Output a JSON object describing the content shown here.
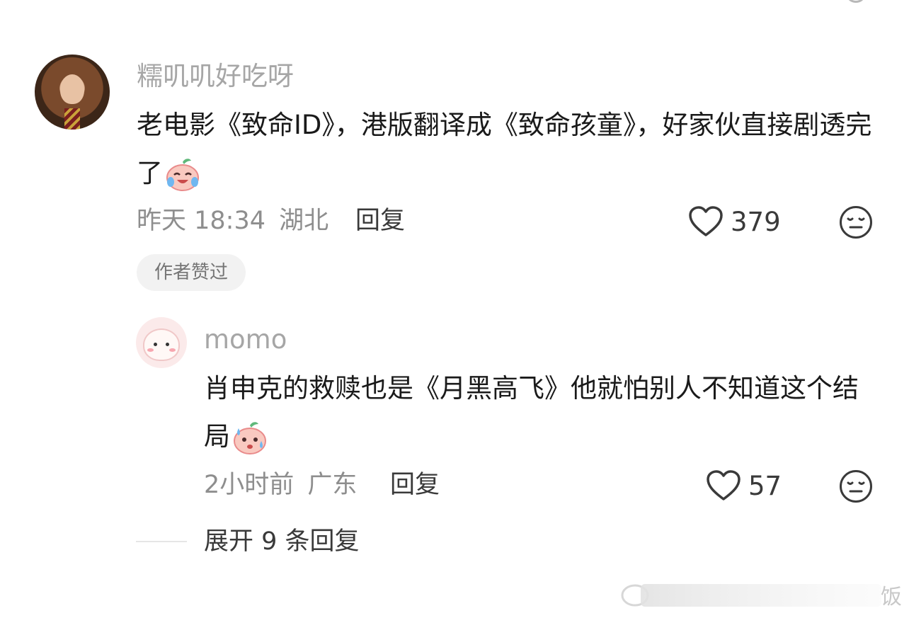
{
  "comment": {
    "username": "糯叽叽好吃呀",
    "content": "老电影《致命ID》，港版翻译成《致命孩童》，好家伙直接剧透完了",
    "content_emoji": "crying-laughing-emoji",
    "time": "昨天 18:34",
    "location": "湖北",
    "reply_label": "回复",
    "likes": "379",
    "badge": "作者赞过"
  },
  "reply": {
    "username": "momo",
    "content": "肖申克的救赎也是《月黑高飞》他就怕别人不知道这个结局",
    "content_emoji": "sweat-emoji",
    "time": "2小时前",
    "location": "广东",
    "reply_label": "回复",
    "likes": "57"
  },
  "expand": {
    "label": "展开 9 条回复"
  },
  "watermark": {
    "text": "饭"
  },
  "icons": {
    "like": "heart-outline-icon",
    "more": "neutral-face-icon"
  },
  "colors": {
    "text_primary": "#1a1a1a",
    "text_secondary": "#8e8e8e",
    "username": "#a6a6a6",
    "badge_bg": "#f2f2f2"
  }
}
